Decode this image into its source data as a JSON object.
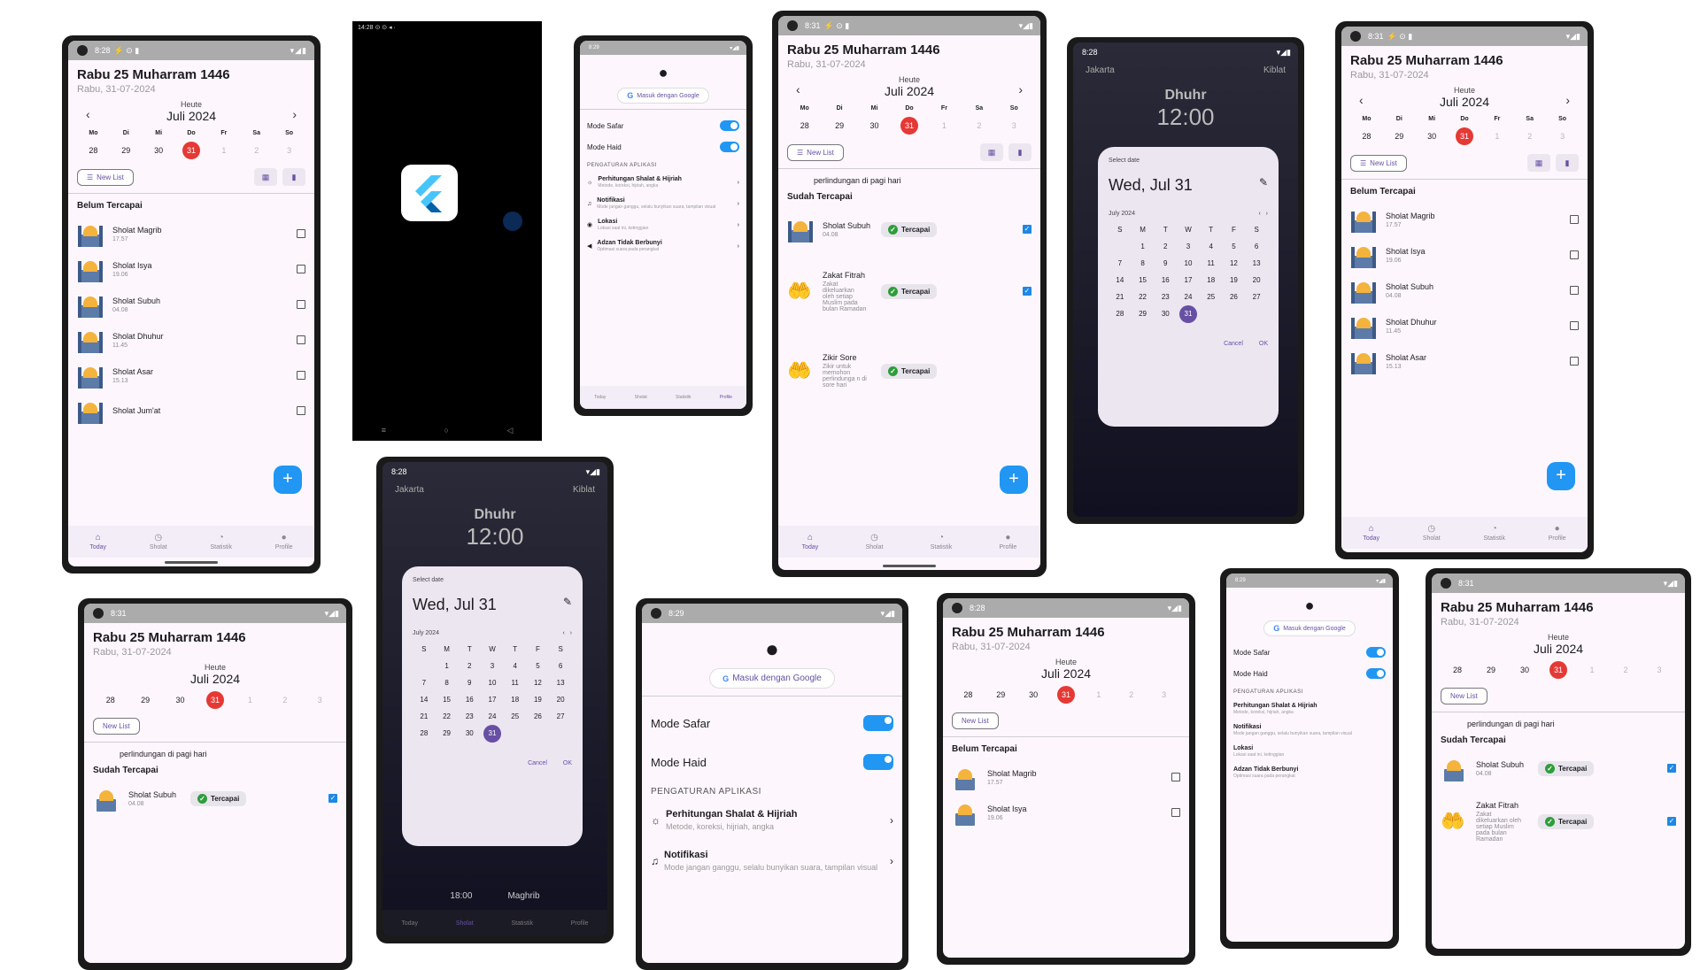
{
  "status": {
    "a": "8:28",
    "b": "14:28",
    "c": "8:29",
    "d": "8:31"
  },
  "home": {
    "title": "Rabu 25 Muharram 1446",
    "date": "Rabu, 31-07-2024",
    "heute": "Heute",
    "month": "Juli 2024",
    "weekdays": [
      "Mo",
      "Di",
      "Mi",
      "Do",
      "Fr",
      "Sa",
      "So"
    ],
    "dates": [
      "28",
      "29",
      "30",
      "31",
      "1",
      "2",
      "3"
    ],
    "new_list": "New List",
    "belum": "Belum Tercapai",
    "sudah": "Sudah Tercapai",
    "pagi": "perlindungan di pagi hari",
    "prayers": [
      {
        "name": "Sholat Magrib",
        "time": "17.57"
      },
      {
        "name": "Sholat Isya",
        "time": "19.06"
      },
      {
        "name": "Sholat Subuh",
        "time": "04.08"
      },
      {
        "name": "Sholat Dhuhur",
        "time": "11.45"
      },
      {
        "name": "Sholat Asar",
        "time": "15.13"
      },
      {
        "name": "Sholat Jum'at",
        "time": ""
      }
    ],
    "done": [
      {
        "name": "Sholat Subuh",
        "desc": "04.08"
      },
      {
        "name": "Zakat Fitrah",
        "desc": "Zakat dikeluarkan oleh setiap Muslim pada bulan Ramadan"
      },
      {
        "name": "Zikir Sore",
        "desc": "Zikir untuk memohon perlindunga n di sore hari"
      }
    ],
    "tercapai": "Tercapai"
  },
  "nav": {
    "today": "Today",
    "sholat": "Sholat",
    "statistik": "Statistik",
    "profile": "Profile"
  },
  "profile": {
    "google": "Masuk dengan Google",
    "safar": "Mode Safar",
    "haid": "Mode Haid",
    "section": "PENGATURAN APLIKASI",
    "rows": [
      {
        "t": "Perhitungan Shalat & Hijriah",
        "s": "Metode, koreksi, hijriah, angka"
      },
      {
        "t": "Notifikasi",
        "s": "Mode jangan ganggu, selalu bunyikan suara, tampilan visual"
      },
      {
        "t": "Lokasi",
        "s": "Lokasi saat ini, ketinggian"
      },
      {
        "t": "Adzan Tidak Berbunyi",
        "s": "Optimasi suara pada perangkat"
      }
    ]
  },
  "picker": {
    "city": "Jakarta",
    "kiblat": "Kiblat",
    "prayer": "Dhuhr",
    "time": "12:00",
    "select": "Select date",
    "big": "Wed, Jul 31",
    "month": "July 2024",
    "dows": [
      "S",
      "M",
      "T",
      "W",
      "T",
      "F",
      "S"
    ],
    "rows": [
      [
        "",
        "1",
        "2",
        "3",
        "4",
        "5",
        "6"
      ],
      [
        "7",
        "8",
        "9",
        "10",
        "11",
        "12",
        "13"
      ],
      [
        "14",
        "15",
        "16",
        "17",
        "18",
        "19",
        "20"
      ],
      [
        "21",
        "22",
        "23",
        "24",
        "25",
        "26",
        "27"
      ],
      [
        "28",
        "29",
        "30",
        "31",
        "",
        "",
        ""
      ]
    ],
    "cancel": "Cancel",
    "ok": "OK",
    "bottom_time": "18:00",
    "bottom_prayer": "Maghrib"
  }
}
